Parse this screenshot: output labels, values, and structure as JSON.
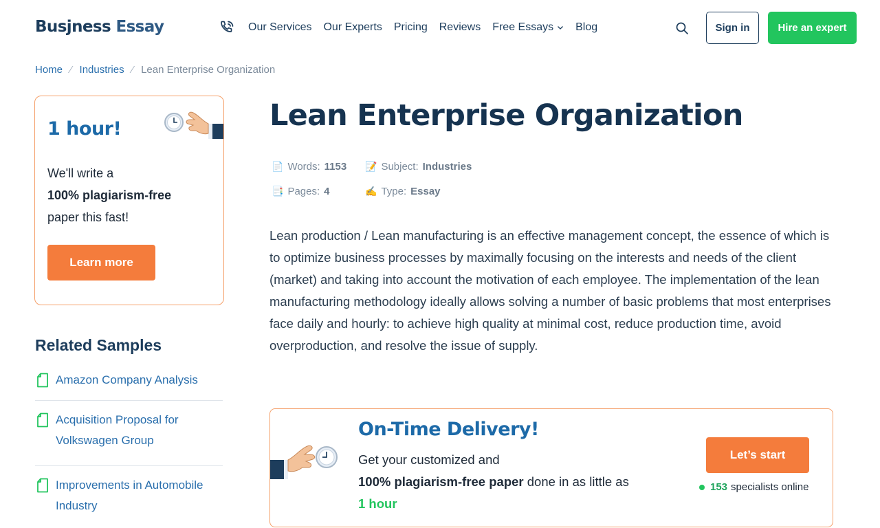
{
  "header": {
    "logo_part1": "Busjness",
    "logo_part2": "Essay",
    "nav": [
      {
        "label": "Our Services"
      },
      {
        "label": "Our Experts"
      },
      {
        "label": "Pricing"
      },
      {
        "label": "Reviews"
      },
      {
        "label": "Free Essays",
        "has_dropdown": true
      },
      {
        "label": "Blog"
      }
    ],
    "signin_label": "Sign in",
    "hire_label": "Hire an expert"
  },
  "breadcrumb": {
    "home": "Home",
    "separator": "⁄",
    "industries": "Industries",
    "current": "Lean Enterprise Organization"
  },
  "promo": {
    "title": "1 hour!",
    "line1": "We'll write a",
    "line2_bold": "100% plagiarism-free",
    "line3": "paper this fast!",
    "button": "Learn more"
  },
  "related": {
    "heading": "Related Samples",
    "items": [
      "Amazon Company Analysis",
      "Acquisition Proposal for Volkswagen Group",
      "Improvements in Automobile Industry"
    ]
  },
  "article": {
    "title": "Lean Enterprise Organization",
    "meta": {
      "words_label": "Words:",
      "words_value": "1153",
      "subject_label": "Subject:",
      "subject_value": "Industries",
      "pages_label": "Pages:",
      "pages_value": "4",
      "type_label": "Type:",
      "type_value": "Essay"
    },
    "body": "Lean production / Lean manufacturing is an effective management concept, the essence of which is to optimize business processes by maximally focusing on the interests and needs of the client (market) and taking into account the motivation of each employee. The implementation of the lean manufacturing methodology ideally allows solving a number of basic problems that most enterprises face daily and hourly: to achieve high quality at minimal cost, reduce production time, avoid overproduction, and resolve the issue of supply."
  },
  "delivery": {
    "title": "On-Time Delivery!",
    "line1": "Get your customized and",
    "bold": "100% plagiarism-free paper",
    "mid": "done in as little as",
    "highlight": "1 hour",
    "button": "Let’s start",
    "online_count": "153",
    "online_label": "specialists online"
  },
  "colors": {
    "brand_navy": "#1d3d5c",
    "link_blue": "#2a6fad",
    "accent_green": "#22c55e",
    "accent_orange": "#f47c3c",
    "card_border": "#f5a06a"
  },
  "icons": [
    "phone-icon",
    "search-icon",
    "chevron-down-icon",
    "clock-hand-icon",
    "document-icon",
    "page-icon",
    "memo-icon",
    "pages-icon",
    "writing-hand-icon"
  ]
}
